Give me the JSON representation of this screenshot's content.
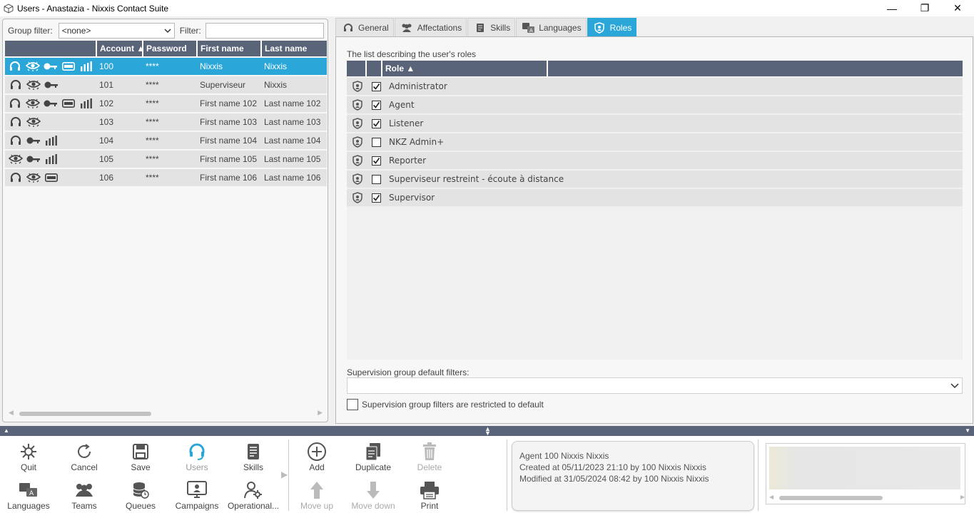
{
  "window": {
    "title": "Users - Anastazia - Nixxis Contact Suite",
    "controls": {
      "minimize": "—",
      "restore": "❐",
      "close": "✕"
    }
  },
  "left": {
    "group_filter_label": "Group filter:",
    "group_filter_value": "<none>",
    "filter_label": "Filter:",
    "filter_value": "",
    "columns": [
      "Account ▲",
      "Password",
      "First name",
      "Last name"
    ],
    "rows": [
      {
        "icons": [
          "headset",
          "eye",
          "key",
          "card",
          "bars"
        ],
        "account": "100",
        "password": "****",
        "first": "Nixxis",
        "last": "Nixxis",
        "selected": true
      },
      {
        "icons": [
          "headset",
          "eye",
          "key"
        ],
        "account": "101",
        "password": "****",
        "first": "Superviseur",
        "last": "Nixxis"
      },
      {
        "icons": [
          "headset",
          "eye",
          "key",
          "card",
          "bars"
        ],
        "account": "102",
        "password": "****",
        "first": "First name 102",
        "last": "Last name 102"
      },
      {
        "icons": [
          "headset",
          "eye"
        ],
        "account": "103",
        "password": "****",
        "first": "First name 103",
        "last": "Last name 103"
      },
      {
        "icons": [
          "headset",
          "key",
          "bars"
        ],
        "account": "104",
        "password": "****",
        "first": "First name 104",
        "last": "Last name 104"
      },
      {
        "icons": [
          "eye",
          "key",
          "bars"
        ],
        "account": "105",
        "password": "****",
        "first": "First name 105",
        "last": "Last name 105"
      },
      {
        "icons": [
          "headset",
          "eye",
          "card"
        ],
        "account": "106",
        "password": "****",
        "first": "First name 106",
        "last": "Last name 106"
      }
    ]
  },
  "tabs": [
    {
      "label": "General",
      "icon": "headset-icon"
    },
    {
      "label": "Affectations",
      "icon": "users-icon"
    },
    {
      "label": "Skills",
      "icon": "document-icon"
    },
    {
      "label": "Languages",
      "icon": "languages-icon"
    },
    {
      "label": "Roles",
      "icon": "shield-icon",
      "active": true
    }
  ],
  "roles": {
    "caption": "The list describing the user's roles",
    "column": "Role ▲",
    "items": [
      {
        "name": "Administrator",
        "checked": true
      },
      {
        "name": "Agent",
        "checked": true
      },
      {
        "name": "Listener",
        "checked": true
      },
      {
        "name": "NKZ Admin+",
        "checked": false
      },
      {
        "name": "Reporter",
        "checked": true
      },
      {
        "name": "Superviseur restreint - écoute à distance",
        "checked": false
      },
      {
        "name": "Supervisor",
        "checked": true
      }
    ],
    "supervision_label": "Supervision group default filters:",
    "supervision_value": "",
    "restrict_label": "Supervision group filters are restricted to default",
    "restrict_checked": false
  },
  "toolbar": {
    "quit": "Quit",
    "cancel": "Cancel",
    "save": "Save",
    "users": "Users",
    "skills": "Skills",
    "languages": "Languages",
    "teams": "Teams",
    "queues": "Queues",
    "campaigns": "Campaigns",
    "operational": "Operational...",
    "add": "Add",
    "duplicate": "Duplicate",
    "delete": "Delete",
    "move_up": "Move up",
    "move_down": "Move down",
    "print": "Print"
  },
  "info": {
    "line1": "Agent 100 Nixxis Nixxis",
    "line2": "Created at 05/11/2023 21:10 by 100 Nixxis Nixxis",
    "line3": "Modified at 31/05/2024 08:42 by 100 Nixxis Nixxis"
  },
  "colors": {
    "accent": "#2aa6d9",
    "header": "#5a6478",
    "row": "#e3e3e3"
  }
}
